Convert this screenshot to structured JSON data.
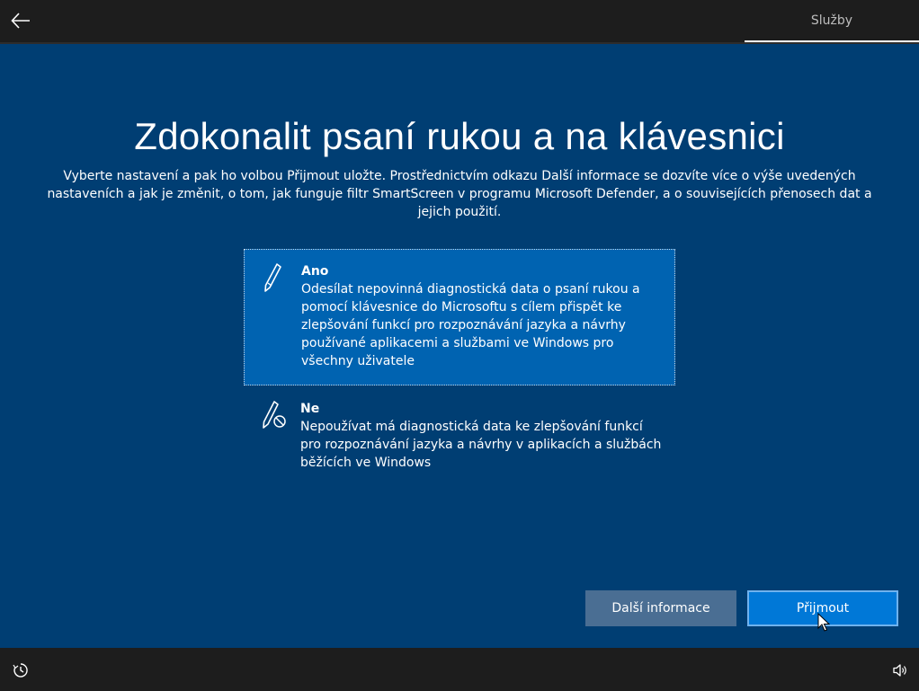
{
  "header": {
    "back_icon": "arrow-left-icon",
    "tab_label": "Služby"
  },
  "main": {
    "title": "Zdokonalit psaní rukou a na klávesnici",
    "subtitle": "Vyberte nastavení a pak ho volbou Přijmout uložte. Prostřednictvím odkazu Další informace se dozvíte více o výše uvedených nastaveních a jak je změnit, o tom, jak funguje filtr SmartScreen v programu Microsoft Defender, a o souvisejících přenosech dat a jejich použití.",
    "options": [
      {
        "icon": "pen-icon",
        "title": "Ano",
        "description": "Odesílat nepovinná diagnostická data o psaní rukou a pomocí klávesnice do Microsoftu s cílem přispět ke zlepšování funkcí pro rozpoznávání jazyka a návrhy používané aplikacemi a službami ve Windows pro všechny uživatele",
        "selected": true
      },
      {
        "icon": "pen-blocked-icon",
        "title": "Ne",
        "description": "Nepoužívat má diagnostická data ke zlepšování funkcí pro rozpoznávání jazyka a návrhy v aplikacích a službách běžících ve Windows",
        "selected": false
      }
    ]
  },
  "buttons": {
    "more_info": "Další informace",
    "accept": "Přijmout"
  },
  "footer": {
    "left_icon": "ease-of-access-icon",
    "right_icon": "volume-icon"
  },
  "colors": {
    "background": "#003e73",
    "bars": "#1d1d1d",
    "selected_option": "#0063b1",
    "accept_button": "#0078d7",
    "info_button": "#4a6e93"
  }
}
